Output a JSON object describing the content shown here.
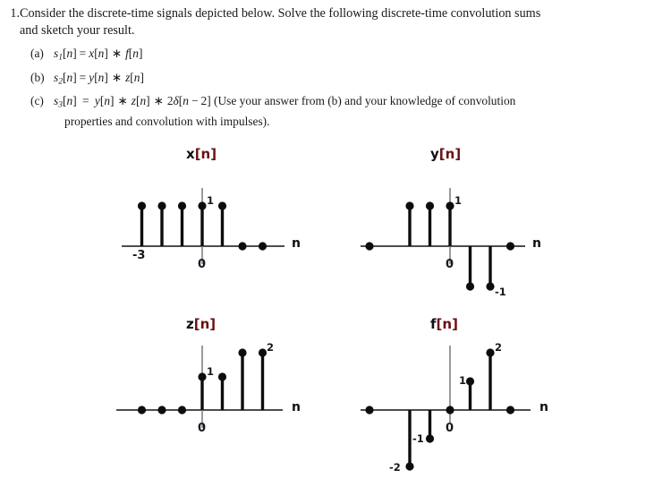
{
  "problem": {
    "number": "1.",
    "statement_line1": "Consider the discrete-time signals depicted below. Solve the following discrete-time convolution sums",
    "statement_line2": "and sketch your result.",
    "parts": [
      {
        "tag": "(a)",
        "lhs_sym": "s",
        "lhs_sub": "1",
        "equation": "s₁[n] = x[n] ∗ f[n]",
        "trailing": ""
      },
      {
        "tag": "(b)",
        "lhs_sym": "s",
        "lhs_sub": "2",
        "equation": "s₂[n] = y[n] ∗ z[n]",
        "trailing": ""
      },
      {
        "tag": "(c)",
        "lhs_sym": "s",
        "lhs_sub": "3",
        "equation": "s₃[n] = y[n] ∗ z[n] ∗ 2δ[n − 2]",
        "trailing_line1": "(Use your answer from (b) and your knowledge of convolution",
        "trailing_line2": "properties and convolution with impulses)."
      }
    ]
  },
  "colors": {
    "ink": "#1a1a1a",
    "stem": "#0d0d0d",
    "axis": "#4d4d4d",
    "title_bracket": "#6b1111",
    "label": "#13181f"
  },
  "chart_data": [
    {
      "type": "stem",
      "name": "x[n]",
      "title": "x[n]",
      "xlabel": "n",
      "ylabel": "",
      "x": [
        -3,
        -2,
        -1,
        0,
        1,
        2,
        3
      ],
      "values": [
        1,
        1,
        1,
        1,
        1,
        0,
        0
      ],
      "xtick_labels": {
        "-3": "-3",
        "0": "0"
      },
      "value_annotations": [
        {
          "x": 0,
          "text": "1",
          "side": "right"
        }
      ],
      "ylim": [
        0,
        1
      ],
      "grid": false
    },
    {
      "type": "stem",
      "name": "y[n]",
      "title": "y[n]",
      "xlabel": "n",
      "ylabel": "",
      "x": [
        -3,
        -2,
        -1,
        0,
        1,
        2,
        3
      ],
      "values": [
        0,
        1,
        1,
        1,
        -1,
        -1,
        0
      ],
      "xtick_labels": {
        "0": "0"
      },
      "value_annotations": [
        {
          "x": 0,
          "text": "1",
          "side": "right"
        },
        {
          "x": 2,
          "text": "-1",
          "side": "right"
        }
      ],
      "ylim": [
        -1,
        1
      ],
      "grid": false
    },
    {
      "type": "stem",
      "name": "z[n]",
      "title": "z[n]",
      "xlabel": "n",
      "ylabel": "",
      "x": [
        -3,
        -2,
        -1,
        0,
        1,
        2,
        3
      ],
      "values": [
        0,
        0,
        0,
        1,
        1,
        2,
        2
      ],
      "xtick_labels": {
        "0": "0"
      },
      "value_annotations": [
        {
          "x": 0,
          "text": "1",
          "side": "right"
        },
        {
          "x": 3,
          "text": "2",
          "side": "right"
        }
      ],
      "ylim": [
        0,
        2
      ],
      "grid": false
    },
    {
      "type": "stem",
      "name": "f[n]",
      "title": "f[n]",
      "xlabel": "n",
      "ylabel": "",
      "x": [
        -3,
        -2,
        -1,
        0,
        1,
        2,
        3
      ],
      "values": [
        0,
        -2,
        -1,
        0,
        1,
        2,
        0
      ],
      "xtick_labels": {
        "0": "0"
      },
      "value_annotations": [
        {
          "x": -2,
          "text": "-2",
          "side": "left"
        },
        {
          "x": -1,
          "text": "-1",
          "side": "left"
        },
        {
          "x": 1,
          "text": "1",
          "side": "left"
        },
        {
          "x": 2,
          "text": "2",
          "side": "right"
        }
      ],
      "ylim": [
        -2,
        2
      ],
      "grid": false
    }
  ]
}
